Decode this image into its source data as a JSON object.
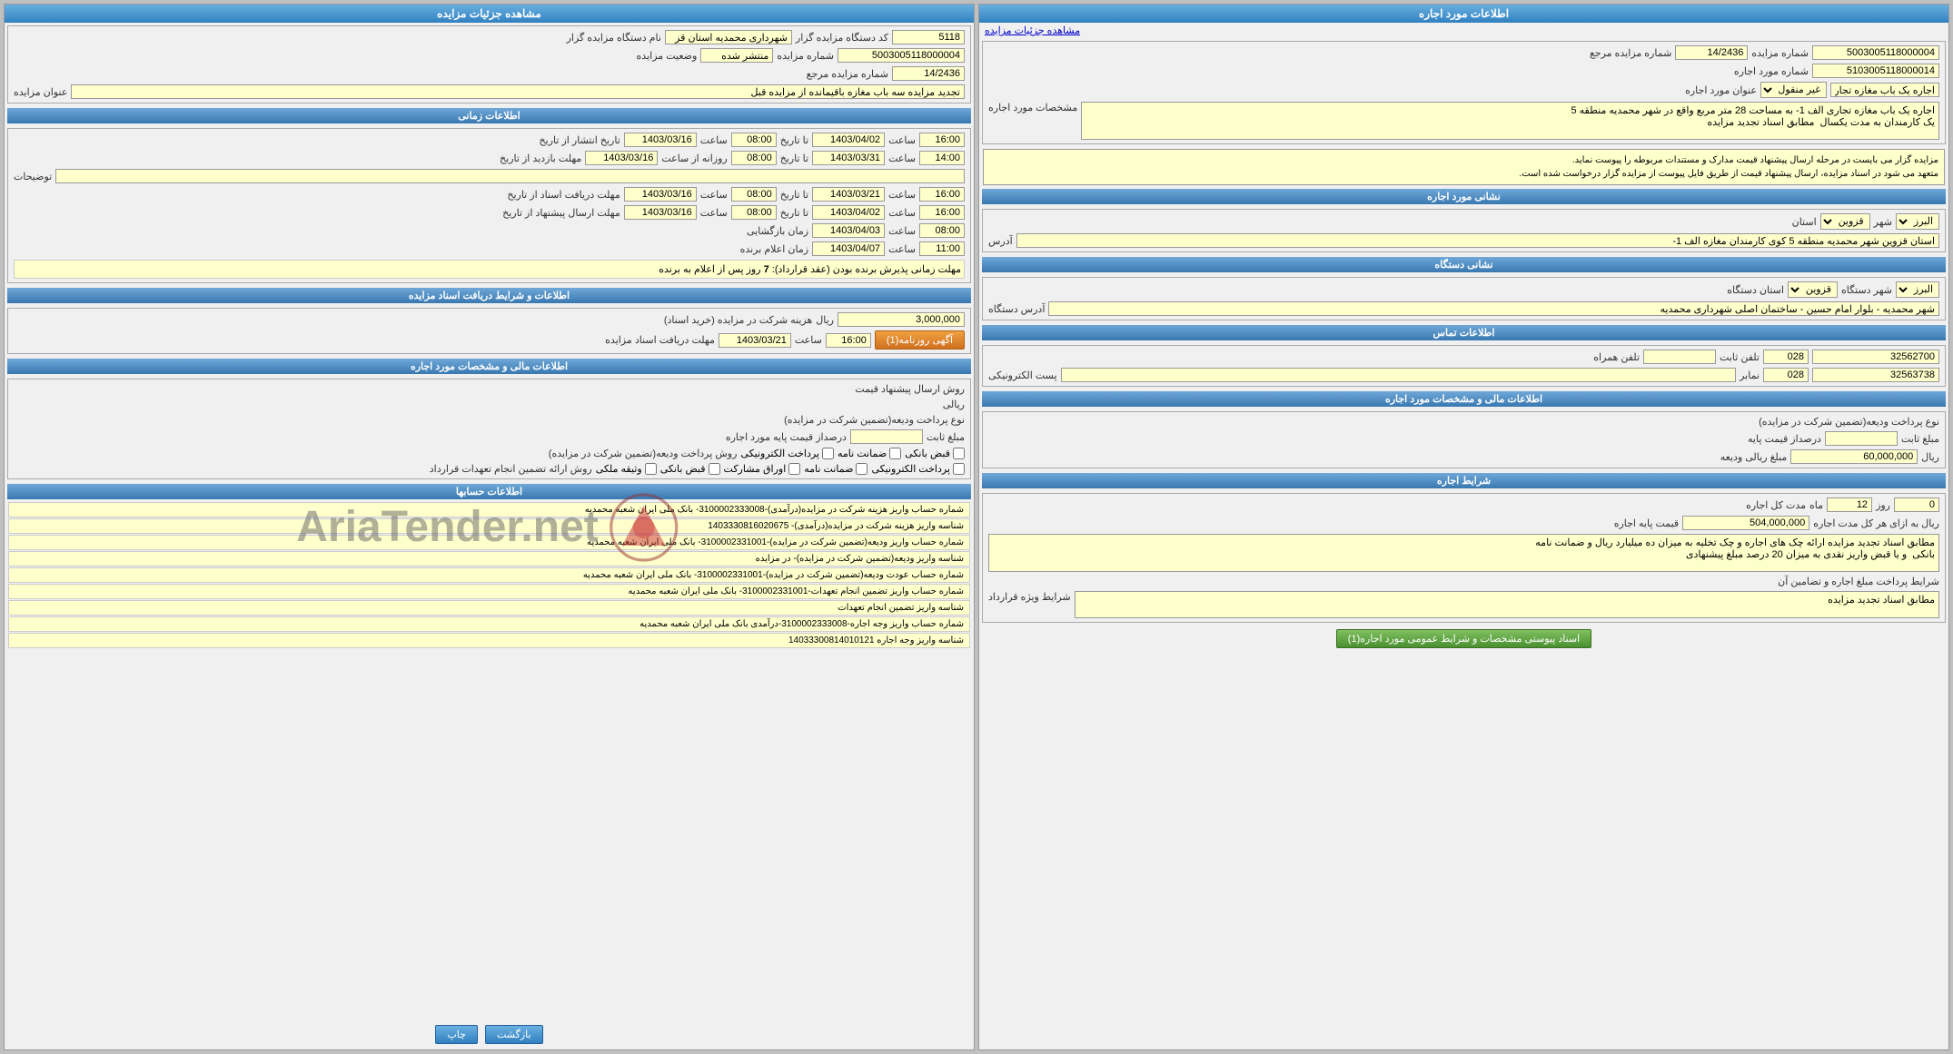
{
  "left_panel": {
    "title": "اطلاعات مورد اجاره",
    "auction_link": "مشاهده جزئیات مزایده",
    "fields": {
      "auction_number_label": "شماره مزایده",
      "auction_number_value": "5003005118000004",
      "ref_number_label": "شماره مزایده مرجع",
      "ref_number_value": "14/2436",
      "rent_number_label": "شماره مورد اجاره",
      "rent_number_value": "5103005118000014",
      "subject_label": "عنوان مورد اجاره",
      "subject_value": "اجاره یک باب مغازه تجاری الف",
      "subject_type": "غیر منقول",
      "description_label": "مشخصات مورد اجاره",
      "description_value": "اجاره یک باب مغازه تجاری الف 1- به مساحت 28 متر مربع واقع در شهر محمدیه منطقه 5\nیک کارمندان به مدت یکسال  مطابق اسناد تجدید مزایده"
    },
    "location": {
      "title": "نشانی مورد اجاره",
      "province_label": "استان",
      "province_value": "قزوین",
      "city_label": "شهر",
      "city_value": "البرز",
      "address_label": "آدرس",
      "address_value": "استان قزوین شهر محمدیه منطقه 5 کوی کارمندان مغازه الف 1-"
    },
    "agency": {
      "title": "نشانی دستگاه",
      "province_label": "استان دستگاه",
      "province_value": "قزوین",
      "city_label": "شهر دستگاه",
      "city_value": "البرز",
      "address_label": "آدرس دستگاه",
      "address_value": "شهر محمدیه - بلوار امام حسین - ساختمان اصلی شهرداری محمدیه"
    },
    "contact": {
      "title": "اطلاعات تماس",
      "phone_label": "تلفن ثابت",
      "phone_code": "028",
      "phone_value": "32562700",
      "mobile_label": "تلفن همراه",
      "fax_label": "نمابر",
      "fax_code": "028",
      "fax_value": "32563738",
      "email_label": "پست الکترونیکی"
    },
    "financial": {
      "title": "اطلاعات مالی و مشخصات مورد اجاره",
      "deposit_label": "نوع پرداخت ودیعه(تضمین شرکت در مزایده)",
      "percent_label": "درصداز قیمت پایه",
      "fixed_label": "مبلغ ثابت",
      "amount_label": "مبلغ ریالی ودیعه",
      "amount_value": "60,000,000",
      "currency": "ریال"
    },
    "conditions": {
      "title": "شرایط اجاره",
      "duration_label": "مدت کل اجاره",
      "duration_months": "12",
      "duration_days": "0",
      "duration_unit": "روز",
      "duration_unit2": "ماه",
      "base_price_label": "قیمت پایه اجاره",
      "base_price_value": "504,000,000",
      "base_price_unit": "ریال به ازای هر کل مدت اجاره",
      "conditions_text": "مطابق اسناد تجدید مزایده ارائه چک های اجاره و چک تخلیه به میزان ده میلیارد ریال و ضمانت نامه\nبانکی  و یا قبض واریز نقدی به میزان 20 درصد مبلغ پیشنهادی",
      "special_conditions_label": "شرایط ویژه قرارداد",
      "special_conditions_text": "مطابق اسناد تجدید مزایده",
      "payment_label": "شرایط پرداخت مبلغ اجاره و تضامین آن"
    },
    "btn_label": "اسناد پیوستی مشخصات و شرایط عمومی مورد اجاره(1)"
  },
  "right_panel": {
    "title": "مشاهده جزئیات مزایده",
    "fields": {
      "agency_code_label": "کد دستگاه مزایده گزار",
      "agency_code_value": "5118",
      "agency_name_label": "نام دستگاه مزایده گزار",
      "agency_name_value": "شهرداری محمدیه استان قز",
      "auction_number_label": "شماره مزایده",
      "auction_number_value": "5003005118000004",
      "status_label": "وضعیت مزایده",
      "status_value": "منتشر شده",
      "ref_label": "شماره مزایده مرجع",
      "ref_value": "14/2436",
      "title_label": "عنوان مزایده",
      "title_value": "تجدید مزایده سه باب مغازه باقیمانده از مزایده قبل"
    },
    "timing": {
      "title": "اطلاعات زمانی",
      "publish_start_label": "تاریخ انتشار از تاریخ",
      "publish_start_date": "1403/03/16",
      "publish_start_time": "08:00",
      "publish_end_label": "تا تاریخ",
      "publish_end_date": "1403/04/02",
      "publish_end_time": "16:00",
      "sale_start_label": "مهلت بازدید از تاریخ",
      "sale_start_date": "1403/03/16",
      "sale_start_time": "08:00",
      "sale_end_label": "تا تاریخ",
      "sale_end_date": "1403/03/31",
      "sale_end_time": "14:00",
      "notes_label": "توضیحات",
      "doc_receive_label": "مهلت دریافت اسناد از تاریخ",
      "doc_receive_start_date": "1403/03/16",
      "doc_receive_start_time": "08:00",
      "doc_receive_end_date": "1403/03/21",
      "doc_receive_end_time": "16:00",
      "offer_send_label": "مهلت ارسال پیشنهاد از تاریخ",
      "offer_send_start_date": "1403/03/16",
      "offer_send_start_time": "08:00",
      "offer_send_end_date": "1403/04/02",
      "offer_send_end_time": "16:00",
      "open_label": "زمان بازگشایی",
      "open_date": "1403/04/03",
      "open_time": "08:00",
      "winner_label": "زمان اعلام برنده",
      "winner_date": "1403/04/07",
      "winner_time": "11:00",
      "contract_note": "مهلت زمانی پذیرش برنده بودن (عقد قرارداد): 7 روز پس از اعلام به برنده"
    },
    "docs": {
      "title": "اطلاعات و شرایط دریافت اسناد مزایده",
      "fee_label": "هزینه شرکت در مزایده (خرید اسناد)",
      "fee_value": "3,000,000",
      "fee_unit": "ریال",
      "deadline_label": "مهلت دریافت اسناد مزایده",
      "deadline_date": "1403/03/21",
      "deadline_time": "16:00",
      "btn_label": "آگهی روزنامه(1)"
    },
    "financial": {
      "title": "اطلاعات مالی و مشخصات مورد اجاره",
      "price_method_label": "روش ارسال پیشنهاد قیمت",
      "price_method_value": "",
      "currency_label": "ریالی",
      "deposit_type_label": "نوع پرداخت ودیعه(تضمین شرکت در مزایده)",
      "percent_label": "درصداز قیمت پایه مورد اجاره",
      "fixed_label": "مبلغ ثابت",
      "deposit_methods_label": "روش پرداخت ودیعه(تضمین شرکت در مزایده)",
      "deposit_options": [
        "قبض بانکی",
        "ضمانت نامه",
        "پرداخت الکترونیکی"
      ],
      "contract_methods_label": "روش ارائه تضمین انجام تعهدات قرارداد",
      "contract_options": [
        "پرداخت الکترونیکی",
        "ضمانت نامه",
        "اوراق مشارکت",
        "قبض بانکی",
        "وثیقه ملکی"
      ]
    },
    "accounts": {
      "title": "اطلاعات حسابها",
      "rows": [
        "شماره حساب واریز هزینه شرکت در مزایده(درآمدی)-3100002333008- بانک ملی ایران شعبه محمدیه",
        "شناسه واریز هزینه شرکت در مزایده(درآمدی)- 1403330816020675",
        "شماره حساب واریز ودیعه(تضمین شرکت در مزایده)-3100002331001- بانک ملی ایران شعبه محمدیه",
        "شناسه واریز ودیعه(تضمین شرکت در مزایده)- در مزایده",
        "شماره حساب عودت ودیعه(تضمین شرکت در مزایده)-3100002331001- بانک ملی ایران شعبه محمدیه",
        "شماره حساب واریز تضمین انجام تعهدات-3100002331001- بانک ملی ایران شعبه محمدیه",
        "شناسه واریز تضمین انجام تعهدات",
        "شماره حساب واریز وجه اجاره-3100002333008-درآمدی بانک ملی ایران شعبه محمدیه",
        "شناسه واریز وجه اجاره 14033300814010121"
      ]
    },
    "buttons": {
      "print": "چاپ",
      "back": "بازگشت"
    }
  }
}
